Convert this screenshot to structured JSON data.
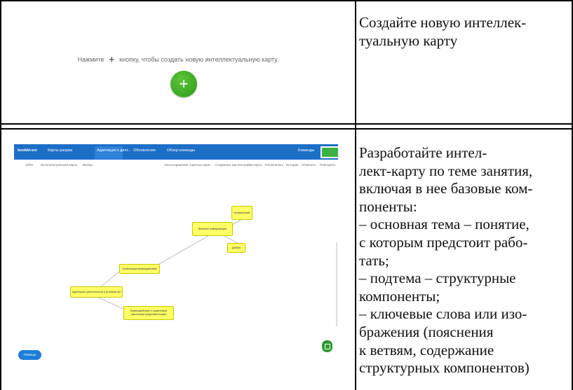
{
  "row1": {
    "hint_before": "Нажмите",
    "hint_plus": "+",
    "hint_after": "кнопку, чтобы создать новую интеллектуальную карту.",
    "add_button": "+",
    "instruction": "Создайте новую интеллек-\nтуальную карту"
  },
  "row2": {
    "instruction": "Разработайте интел-\nлект-карту по теме занятия,\nвключая в нее базовые ком-\nпоненты:\n– основная тема – понятие,\nс которым предстоит рабо-\nтать;\n– подтема – структурные\nкомпоненты;\n– ключевые слова или изо-\nбражения (пояснения\nк ветвям, содержание\nструктурных компонентов)"
  },
  "app": {
    "logo": "bookbl.ore",
    "tabs": [
      "Карты разума",
      "Адаптация к деят...",
      "Обновления",
      "Обзор команды"
    ],
    "topbar_right": "Команды",
    "green_button": "Обновление",
    "toolbar_left": [
      "100%",
      "Интеллектуальная карта",
      "Выбор"
    ],
    "toolbar_right": [
      "Автосохранение отдельно",
      "Цепь",
      "Сохранить как",
      "Настройки карты",
      "Распечатать",
      "История",
      "Отменить",
      "Повторить"
    ],
    "nodes": [
      "Адаптация к деятельности в условиях ДО",
      "Организация взаимодействия",
      "Взаимодействие с родителями (законными представителями)",
      "Внешние коммуникации",
      "Конференции",
      "Дебаты"
    ],
    "help_button": "Помощь"
  },
  "colors": {
    "accent_blue": "#1c6fc7",
    "add_green": "#3aa821",
    "node_yellow": "#ffff66"
  }
}
